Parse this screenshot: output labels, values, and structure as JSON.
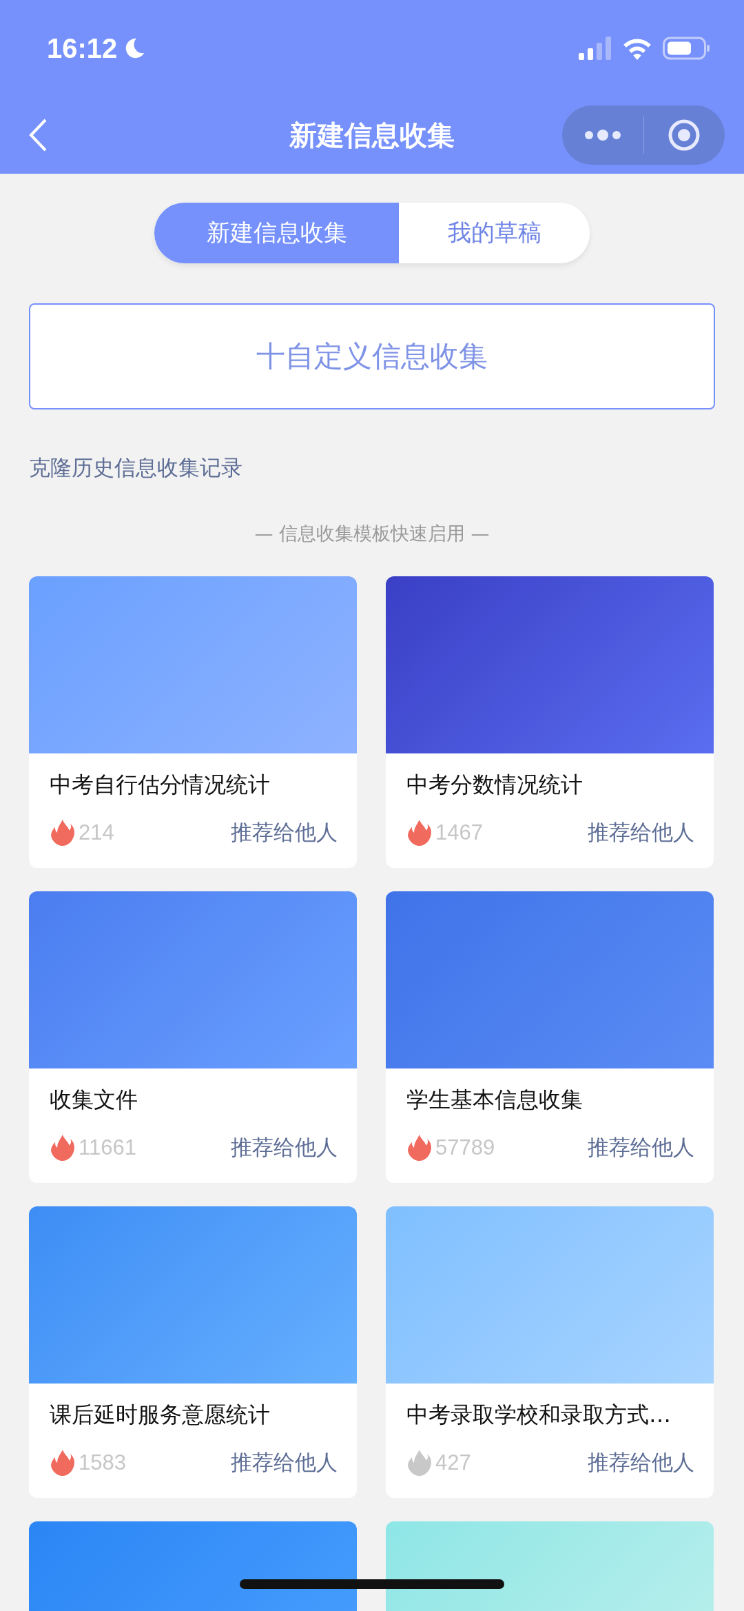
{
  "status_bar": {
    "time": "16:12"
  },
  "nav": {
    "title": "新建信息收集"
  },
  "tabs": [
    {
      "label": "新建信息收集",
      "selected": true
    },
    {
      "label": "我的草稿",
      "selected": false
    }
  ],
  "custom_button": "十自定义信息收集",
  "clone_link": "克隆历史信息收集记录",
  "section_title": "— 信息收集模板快速启用 —",
  "cards": [
    {
      "kind": "full",
      "title": "中考自行估分情况统计",
      "hot": true,
      "count": "214",
      "action": "推荐给他人"
    },
    {
      "kind": "full",
      "title": "中考分数情况统计",
      "hot": true,
      "count": "1467",
      "action": "推荐给他人"
    },
    {
      "kind": "full",
      "title": "收集文件",
      "hot": true,
      "count": "11661",
      "action": "推荐给他人"
    },
    {
      "kind": "full",
      "title": "学生基本信息收集",
      "hot": true,
      "count": "57789",
      "action": "推荐给他人"
    },
    {
      "kind": "full",
      "title": "课后延时服务意愿统计",
      "hot": true,
      "count": "1583",
      "action": "推荐给他人"
    },
    {
      "kind": "full",
      "title": "中考录取学校和录取方式…",
      "hot": false,
      "count": "427",
      "action": "推荐给他人"
    },
    {
      "kind": "banner_only"
    },
    {
      "kind": "banner_only"
    }
  ]
}
